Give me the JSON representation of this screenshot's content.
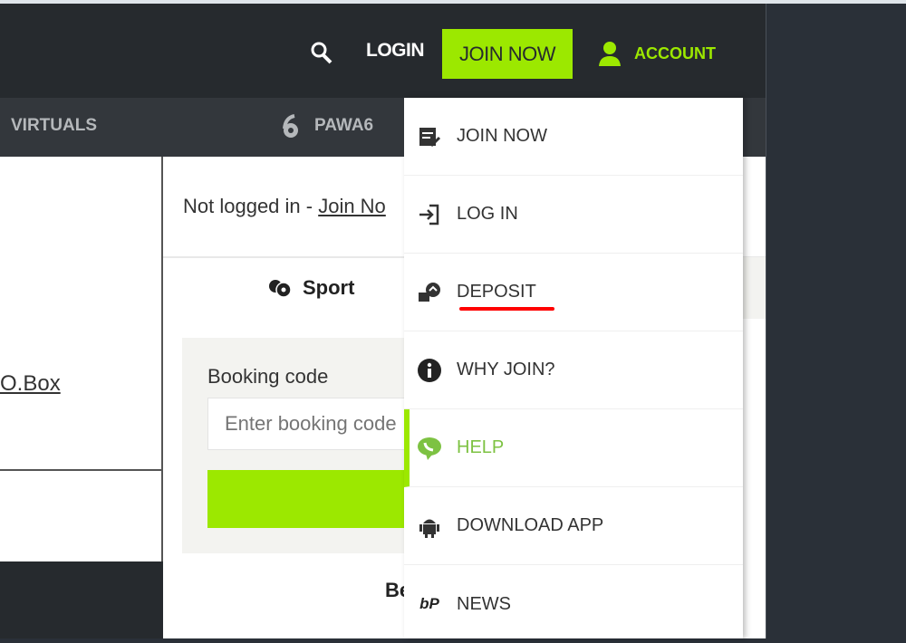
{
  "header": {
    "login": "LOGIN",
    "join_now": "JOIN NOW",
    "account": "ACCOUNT"
  },
  "nav": {
    "virtuals": "VIRTUALS",
    "pawa6": "PAWA6"
  },
  "left": {
    "pobox": "O.Box"
  },
  "main": {
    "not_logged": "Not logged in - ",
    "join_link": "Join No",
    "sport_tab": "Sport",
    "booking_label": "Booking code",
    "booking_placeholder": "Enter booking code",
    "bottom_text": "Be"
  },
  "dropdown": {
    "items": [
      {
        "label": "JOIN NOW",
        "icon": "register-icon"
      },
      {
        "label": "LOG IN",
        "icon": "login-icon"
      },
      {
        "label": "DEPOSIT",
        "icon": "deposit-icon"
      },
      {
        "label": "WHY JOIN?",
        "icon": "info-icon"
      },
      {
        "label": "HELP",
        "icon": "phone-chat-icon",
        "active": true
      },
      {
        "label": "DOWNLOAD APP",
        "icon": "android-icon"
      },
      {
        "label": "NEWS",
        "icon": "bp-logo-icon"
      }
    ]
  },
  "colors": {
    "brand_green": "#9ce800",
    "header_bg": "#262a2e",
    "annotation_red": "#ff0000"
  }
}
